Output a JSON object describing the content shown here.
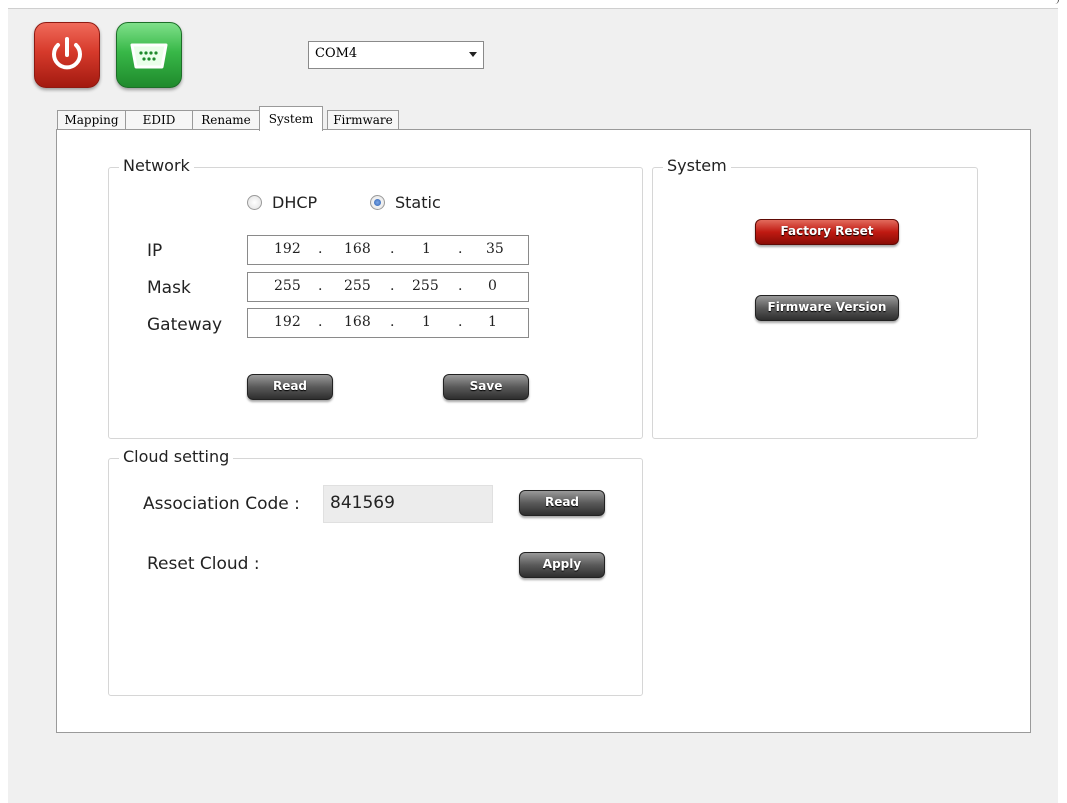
{
  "toolbar": {
    "power_icon": "power-icon",
    "serial_icon": "serial-port-icon",
    "com_port": "COM4"
  },
  "tabs": [
    {
      "label": "Mapping",
      "active": false
    },
    {
      "label": "EDID",
      "active": false
    },
    {
      "label": "Rename",
      "active": false
    },
    {
      "label": "System",
      "active": true
    },
    {
      "label": "Firmware",
      "active": false
    }
  ],
  "network": {
    "title": "Network",
    "mode_dhcp": "DHCP",
    "mode_static": "Static",
    "selected_mode": "Static",
    "ip_label": "IP",
    "ip": [
      "192",
      "168",
      "1",
      "35"
    ],
    "mask_label": "Mask",
    "mask": [
      "255",
      "255",
      "255",
      "0"
    ],
    "gateway_label": "Gateway",
    "gateway": [
      "192",
      "168",
      "1",
      "1"
    ],
    "dot": ".",
    "read_label": "Read",
    "save_label": "Save"
  },
  "system": {
    "title": "System",
    "factory_reset_label": "Factory Reset",
    "firmware_version_label": "Firmware Version"
  },
  "cloud": {
    "title": "Cloud setting",
    "association_label": "Association Code :",
    "association_code": "841569",
    "read_label": "Read",
    "reset_label": "Reset Cloud :",
    "apply_label": "Apply"
  },
  "colors": {
    "power": "#d63a2b",
    "serial": "#38b848",
    "factory_reset": "#c01a12",
    "button_dark": "#4a4a4a"
  }
}
